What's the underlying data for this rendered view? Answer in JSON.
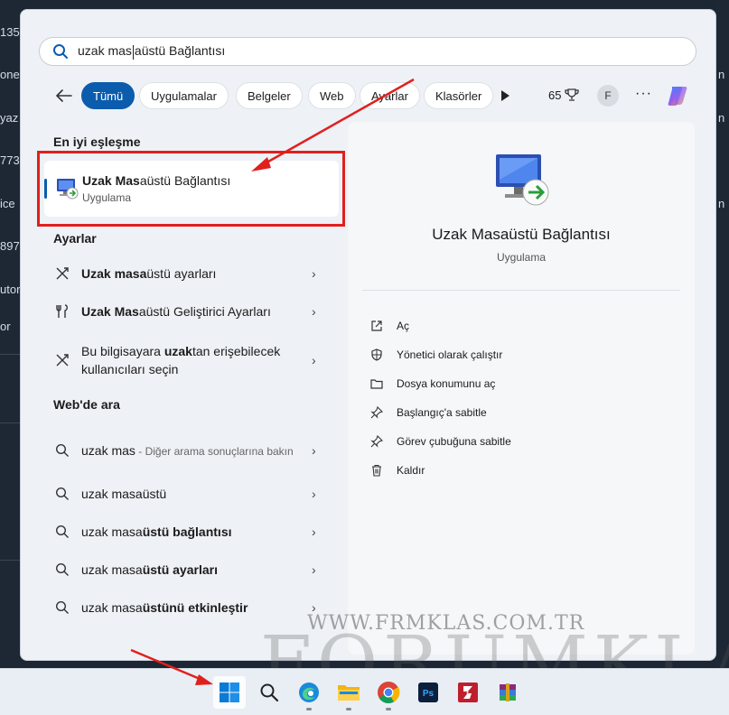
{
  "background": {
    "left_snippets": [
      "135",
      "one",
      "yaz",
      "773",
      "ice",
      "897",
      "utor",
      "or"
    ],
    "right_snippets": [
      "n",
      "n",
      "n"
    ]
  },
  "search": {
    "query_before_caret": "uzak mas",
    "query_after_caret": "aüstü Bağlantısı"
  },
  "filters": {
    "chips": [
      "Tümü",
      "Uygulamalar",
      "Belgeler",
      "Web",
      "Ayarlar",
      "Klasörler"
    ],
    "points": "65",
    "avatar_letter": "F"
  },
  "best_match": {
    "header": "En iyi eşleşme",
    "title_bold": "Uzak Mas",
    "title_rest": "aüstü Bağlantısı",
    "subtitle": "Uygulama"
  },
  "settings": {
    "header": "Ayarlar",
    "items": [
      {
        "bold": "Uzak masa",
        "rest": "üstü ayarları",
        "icon": "remote-icon"
      },
      {
        "bold": "Uzak Mas",
        "rest": "aüstü Geliştirici Ayarları",
        "icon": "tools-icon"
      },
      {
        "pre": "Bu bilgisayara ",
        "bold": "uzak",
        "rest": "tan erişebilecek kullanıcıları seçin",
        "icon": "remote-icon"
      }
    ]
  },
  "web": {
    "header": "Web'de ara",
    "items": [
      {
        "text": "uzak mas",
        "gray": " - Diğer arama sonuçlarına bakın"
      },
      {
        "text": "uzak masaüstü",
        "bold": ""
      },
      {
        "text": "uzak masa",
        "bold": "üstü bağlantısı"
      },
      {
        "text": "uzak masa",
        "bold": "üstü ayarları"
      },
      {
        "text": "uzak masa",
        "bold": "üstünü etkinleştir"
      }
    ]
  },
  "detail": {
    "title": "Uzak Masaüstü Bağlantısı",
    "subtitle": "Uygulama",
    "actions": [
      {
        "label": "Aç",
        "icon": "open-icon"
      },
      {
        "label": "Yönetici olarak çalıştır",
        "icon": "shield-icon"
      },
      {
        "label": "Dosya konumunu aç",
        "icon": "folder-icon"
      },
      {
        "label": "Başlangıç'a sabitle",
        "icon": "pin-icon"
      },
      {
        "label": "Görev çubuğuna sabitle",
        "icon": "pin-icon"
      },
      {
        "label": "Kaldır",
        "icon": "trash-icon"
      }
    ]
  },
  "watermark": {
    "url": "WWW.FRMKLAS.COM.TR",
    "name": "FORUMKLAS"
  },
  "taskbar": {
    "apps": [
      "start-icon",
      "search-icon",
      "edge-icon",
      "file-explorer-icon",
      "chrome-icon",
      "photoshop-icon",
      "filezilla-icon",
      "winrar-icon"
    ]
  },
  "colors": {
    "accent": "#0b5cad",
    "highlight_red": "#e0201d"
  }
}
